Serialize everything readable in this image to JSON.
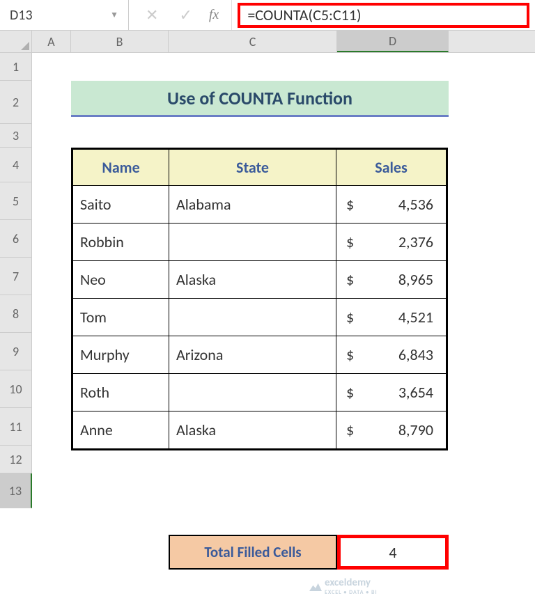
{
  "formula_bar": {
    "cell_ref": "D13",
    "formula": "=COUNTA(C5:C11)"
  },
  "columns": [
    "A",
    "B",
    "C",
    "D"
  ],
  "rows": [
    "1",
    "2",
    "3",
    "4",
    "5",
    "6",
    "7",
    "8",
    "9",
    "10",
    "11",
    "12",
    "13"
  ],
  "title": "Use of COUNTA Function",
  "table": {
    "headers": {
      "name": "Name",
      "state": "State",
      "sales": "Sales"
    },
    "rows": [
      {
        "name": "Saito",
        "state": "Alabama",
        "currency": "$",
        "sales": "4,536"
      },
      {
        "name": "Robbin",
        "state": "",
        "currency": "$",
        "sales": "2,376"
      },
      {
        "name": "Neo",
        "state": "Alaska",
        "currency": "$",
        "sales": "8,965"
      },
      {
        "name": "Tom",
        "state": "",
        "currency": "$",
        "sales": "4,521"
      },
      {
        "name": "Murphy",
        "state": "Arizona",
        "currency": "$",
        "sales": "6,843"
      },
      {
        "name": "Roth",
        "state": "",
        "currency": "$",
        "sales": "3,654"
      },
      {
        "name": "Anne",
        "state": "Alaska",
        "currency": "$",
        "sales": "8,790"
      }
    ]
  },
  "total": {
    "label": "Total Filled Cells",
    "value": "4"
  },
  "watermark": {
    "brand": "exceldemy",
    "tagline": "EXCEL • DATA • BI"
  }
}
